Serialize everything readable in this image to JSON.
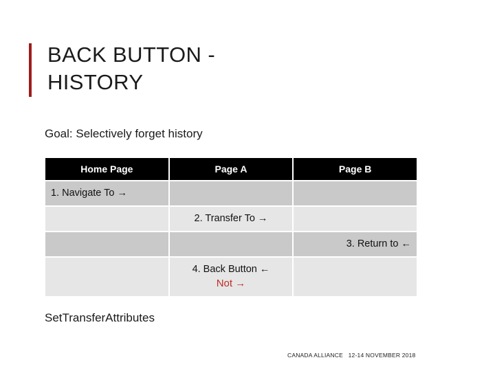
{
  "slide": {
    "title": "BACK BUTTON -\nHISTORY",
    "accent_color": "#9E1B1B",
    "goal_text": "Goal: Selectively forget history",
    "caption": "SetTransferAttributes",
    "footer": "CANADA ALLIANCE   12-14 NOVEMBER 2018"
  },
  "table": {
    "headers": [
      "Home Page",
      "Page A",
      "Page B"
    ],
    "header_bg": "#000000",
    "header_fg": "#FFFFFF",
    "row_dark_bg": "#C9C9C9",
    "row_light_bg": "#E6E6E6",
    "highlight_color": "#BF2E25",
    "rows": [
      {
        "cells": [
          {
            "text": "1. Navigate To →",
            "align": "left"
          },
          {
            "text": "",
            "align": "center"
          },
          {
            "text": "",
            "align": "center"
          }
        ]
      },
      {
        "cells": [
          {
            "text": "",
            "align": "center"
          },
          {
            "text": "2. Transfer To →",
            "align": "center"
          },
          {
            "text": "",
            "align": "center"
          }
        ]
      },
      {
        "cells": [
          {
            "text": "",
            "align": "center"
          },
          {
            "text": "",
            "align": "center"
          },
          {
            "text": "3. Return to ←",
            "align": "right"
          }
        ]
      },
      {
        "cells": [
          {
            "text": "",
            "align": "center"
          },
          {
            "text": "4. Back Button ←",
            "align": "center",
            "sub_text": "Not →"
          },
          {
            "text": "",
            "align": "center"
          }
        ]
      }
    ]
  }
}
